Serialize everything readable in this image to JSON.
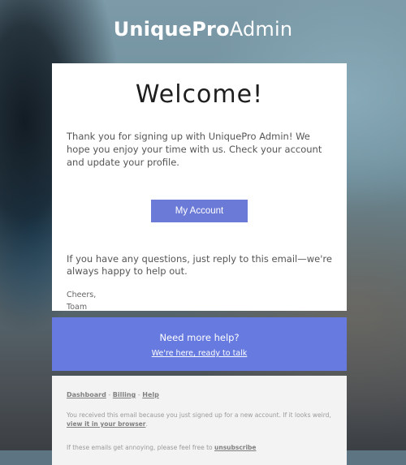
{
  "brand": {
    "bold": "UniquePro",
    "light": "Admin"
  },
  "main": {
    "title": "Welcome!",
    "intro": "Thank you for signing up with UniquePro Admin! We hope you enjoy your time with us. Check your account and update your profile.",
    "button_label": "My Account",
    "questions": "If you have any questions, just reply to this email—we're always happy to help out.",
    "signoff": "Cheers,",
    "signature": "Toam"
  },
  "help": {
    "title": "Need more help?",
    "link": "We're here, ready to talk"
  },
  "footer": {
    "links": [
      "Dashboard",
      "Billing",
      "Help"
    ],
    "separator": " - ",
    "note_prefix": "You received this email because you just signed up for a new account. If it looks weird, ",
    "note_link": "view it in your browser",
    "note_suffix": ".",
    "note2_prefix": "If these emails get annoying, please feel free to ",
    "note2_link": "unsubscribe"
  },
  "colors": {
    "button": "#6a7ad6",
    "help_band": "#667adf",
    "footer_bg": "#f3f3f3"
  }
}
